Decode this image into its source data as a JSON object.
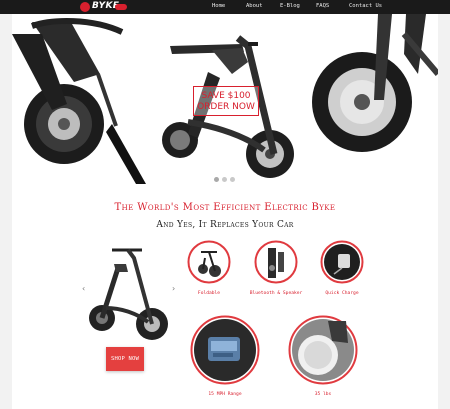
{
  "brand": {
    "logo_text": "BYKE",
    "accent": "#d8202e"
  },
  "nav": {
    "links": [
      {
        "label": "Home"
      },
      {
        "label": "About"
      },
      {
        "label": "E-Blog"
      },
      {
        "label": "FAQS"
      },
      {
        "label": "Contact Us"
      }
    ]
  },
  "hero": {
    "sale_line1": "SAVE $100",
    "sale_line2": "ORDER NOW",
    "carousel_dots": 3
  },
  "headline": "The World's Most Efficient Electric Byke",
  "subline": "And Yes, It Replaces Your Car",
  "product": {
    "shop_label": "SHOP NOW"
  },
  "features": [
    {
      "label": "Foldable"
    },
    {
      "label": "Bluetooth & Speaker"
    },
    {
      "label": "Quick Charge"
    },
    {
      "label": "15 MPH Range"
    },
    {
      "label": "35 lbs"
    }
  ]
}
